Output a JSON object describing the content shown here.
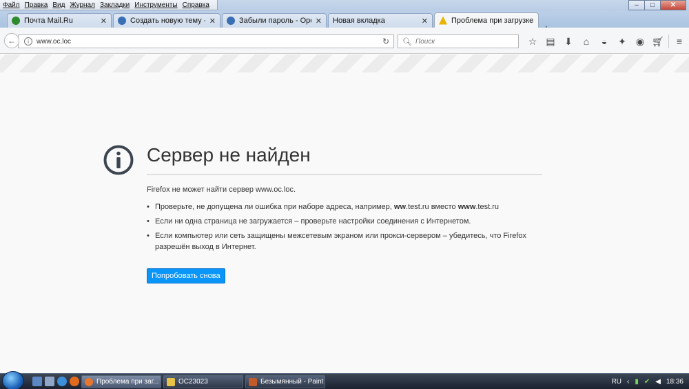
{
  "menu": [
    "Файл",
    "Правка",
    "Вид",
    "Журнал",
    "Закладки",
    "Инструменты",
    "Справка"
  ],
  "window_controls": {
    "minimize": "–",
    "maximize": "□",
    "close": "✕"
  },
  "tabs": [
    {
      "label": "Почта Mail.Ru",
      "icon_color": "#2d8a2d",
      "active": false
    },
    {
      "label": "Создать новую тему - Op...",
      "icon_color": "#3a6fb5",
      "active": false
    },
    {
      "label": "Забыли пароль - OpenCa...",
      "icon_color": "#3a6fb5",
      "active": false
    },
    {
      "label": "Новая вкладка",
      "icon_color": "",
      "active": false
    },
    {
      "label": "Проблема при загрузке с...",
      "icon_color": "#e8b400",
      "active": true
    }
  ],
  "tab_close": "✕",
  "new_tab_label": "+",
  "nav": {
    "url": "www.oc.loc",
    "search_placeholder": "Поиск"
  },
  "error": {
    "title": "Сервер не найден",
    "lead": "Firefox не может найти сервер www.oc.loc.",
    "items": [
      {
        "pre": "Проверьте, не допущена ли ошибка при наборе адреса, например,",
        "b1": "ww",
        "mid1": ".test.ru вместо",
        "b2": "www",
        "mid2": ".test.ru"
      },
      {
        "text": "Если ни одна страница не загружается – проверьте настройки соединения с Интернетом."
      },
      {
        "text": "Если компьютер или сеть защищены межсетевым экраном или прокси-сервером – убедитесь, что Firefox разрешён выход в Интернет."
      }
    ],
    "retry_label": "Попробовать снова"
  },
  "taskbar": {
    "tasks": [
      {
        "label": "Проблема при заг...",
        "icon_color": "#e8772e",
        "active": true
      },
      {
        "label": "OC23023",
        "icon_color": "#e6c24a",
        "active": false
      },
      {
        "label": "Безымянный - Paint",
        "icon_color": "#c25b2a",
        "active": false
      }
    ],
    "lang": "RU",
    "time": "18:36"
  }
}
